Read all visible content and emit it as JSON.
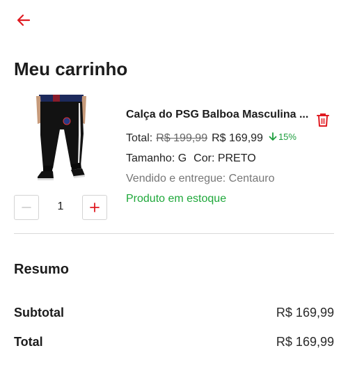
{
  "header": {
    "back_icon": "arrow-left-icon",
    "accent_color": "#e01b22"
  },
  "page": {
    "title": "Meu carrinho"
  },
  "cart_item": {
    "image_icon": "black-track-pants-photo",
    "name": "Calça do PSG Balboa Masculina ...",
    "price_label": "Total:",
    "old_price": "R$ 199,99",
    "new_price": "R$ 169,99",
    "discount": "15%",
    "size_label": "Tamanho: G",
    "color_label": "Cor: PRETO",
    "seller": "Vendido e entregue: Centauro",
    "stock_status": "Produto em estoque",
    "quantity": "1",
    "stock_color": "#1ea83a",
    "discount_color": "#1e9e3e"
  },
  "summary": {
    "title": "Resumo",
    "subtotal_label": "Subtotal",
    "subtotal_value": "R$ 169,99",
    "total_label": "Total",
    "total_value": "R$ 169,99"
  }
}
